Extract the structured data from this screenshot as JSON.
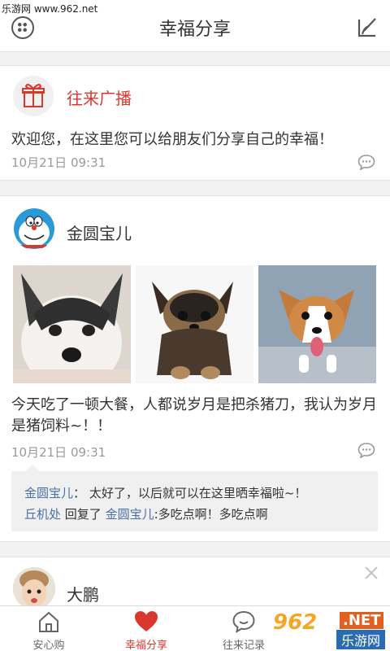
{
  "watermark": {
    "top_text": "乐游网 www.962.net",
    "brand_num": "962",
    "brand_tld": ".NET",
    "brand_site": "乐游网"
  },
  "header": {
    "title": "幸福分享"
  },
  "broadcast": {
    "name": "往来广播",
    "text": "欢迎您，在这里您可以给朋友们分享自己的幸福！",
    "time": "10月21日 09:31"
  },
  "post1": {
    "user": "金圆宝儿",
    "text": "今天吃了一顿大餐，人都说岁月是把杀猪刀，我认为岁月是猪饲料~！！",
    "time": "10月21日 09:31",
    "comments": [
      {
        "user": "金圆宝儿",
        "sep": "：",
        "content": "太好了，以后就可以在这里晒幸福啦~！"
      },
      {
        "user": "丘机处",
        "mid": "回复了",
        "target": "金圆宝儿",
        "content": ":多吃点啊！多吃点啊"
      }
    ]
  },
  "post2": {
    "user": "大鹏"
  },
  "tabs": [
    {
      "label": "安心购",
      "icon": "home-icon"
    },
    {
      "label": "幸福分享",
      "icon": "heart-icon",
      "active": true
    },
    {
      "label": "往来记录",
      "icon": "chat-icon"
    }
  ],
  "colors": {
    "accent": "#d9382f",
    "link": "#4a6fa5"
  }
}
